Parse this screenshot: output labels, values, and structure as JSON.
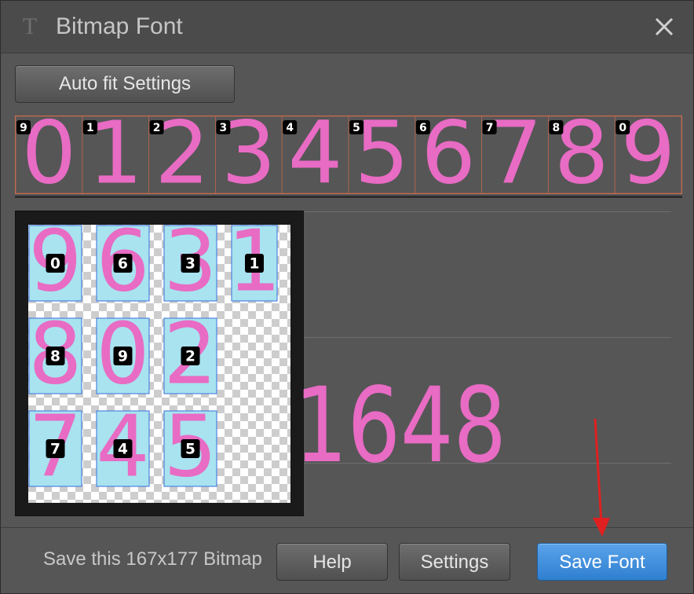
{
  "window": {
    "title": "Bitmap Font",
    "icon": "font-tool-icon",
    "close_icon": "close-icon"
  },
  "toolbar": {
    "autofit_label": "Auto fit Settings"
  },
  "strip": {
    "glyphs": [
      "0",
      "1",
      "2",
      "3",
      "4",
      "5",
      "6",
      "7",
      "8",
      "9"
    ],
    "tags": [
      "9",
      "1",
      "2",
      "3",
      "4",
      "5",
      "6",
      "7",
      "8",
      "0"
    ]
  },
  "atlas": {
    "cells": [
      {
        "glyph": "9",
        "tag": "0"
      },
      {
        "glyph": "6",
        "tag": "6"
      },
      {
        "glyph": "3",
        "tag": "3"
      },
      {
        "glyph": "1",
        "tag": "1"
      },
      {
        "glyph": "8",
        "tag": "8"
      },
      {
        "glyph": "0",
        "tag": "9"
      },
      {
        "glyph": "2",
        "tag": "2"
      },
      {
        "glyph": "7",
        "tag": "7"
      },
      {
        "glyph": "4",
        "tag": "4"
      },
      {
        "glyph": "5",
        "tag": "5"
      }
    ]
  },
  "preview": {
    "text": "1648"
  },
  "footer": {
    "info_text": "Save this 167x177 Bitmap",
    "help_label": "Help",
    "settings_label": "Settings",
    "save_label": "Save Font"
  },
  "colors": {
    "glyph_pink": "#e86bc4",
    "glyph_cell_bg": "#a8e3ef",
    "glyph_cell_border": "#4f83e0",
    "accent_blue": "#3d8ddb",
    "annotation_red": "#e02020"
  }
}
